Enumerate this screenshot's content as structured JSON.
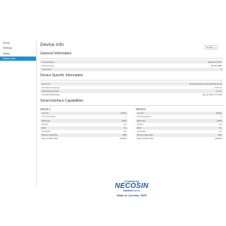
{
  "sidebar": {
    "items": [
      {
        "label": "Home"
      },
      {
        "label": "Settings"
      },
      {
        "label": "Status"
      },
      {
        "label": "Device Info"
      }
    ],
    "active_index": 3
  },
  "header": {
    "title": "Device Info",
    "language": "English"
  },
  "general": {
    "title": "General Information",
    "rows": [
      {
        "label": "Product Name",
        "value": "ESConnect Pro"
      },
      {
        "label": "Product Code",
        "value": "ES-WLNMB"
      },
      {
        "label": "Comments",
        "value": "0"
      }
    ]
  },
  "specific": {
    "title": "Device Specific Information",
    "rows": [
      {
        "label": "Device ID",
        "value": "00:11:E8:00:00:10:00:00:00:00:00:00"
      },
      {
        "label": "Firmware Version(s)",
        "value": "0.5.1.11"
      },
      {
        "label": "HW Module Version",
        "value": "V1.0.0"
      },
      {
        "label": "Firmware Build Date",
        "value": "Sep 11 2024 17:04:48"
      }
    ]
  },
  "serial": {
    "title": "Serial Interface Capabilities",
    "ports": [
      {
        "name": "Serial-1",
        "rows": [
          {
            "label": "Use Port",
            "value": "Enable"
          },
          {
            "label": "TCP Connections",
            "value": "4"
          },
          {
            "label": "Buffer Size",
            "value": "32000"
          },
          {
            "label": "Number",
            "value": "Yes"
          },
          {
            "label": "Mask",
            "value": "Yes"
          },
          {
            "label": "Termination",
            "value": "Yes"
          },
          {
            "label": "Minimum Baud Rate",
            "value": "9600"
          },
          {
            "label": "Maximum Baud Rate",
            "value": "1000000"
          }
        ]
      },
      {
        "name": "Serial-2",
        "rows": [
          {
            "label": "Use Port",
            "value": "Enable"
          },
          {
            "label": "TCP Connections",
            "value": "4"
          },
          {
            "label": "Buffer Size",
            "value": "32000"
          },
          {
            "label": "Number",
            "value": "Yes"
          },
          {
            "label": "Mask",
            "value": "Yes"
          },
          {
            "label": "Termination",
            "value": "Yes"
          },
          {
            "label": "Minimum Baud Rate",
            "value": "9600"
          },
          {
            "label": "Maximum Baud Rate",
            "value": "1000000"
          }
        ]
      }
    ]
  },
  "footer": {
    "created_by": "Created by",
    "brand": "NECOSIN",
    "brand_sub": "Systems s.r.o.",
    "made_in": "Made in Czechia, 2025"
  },
  "colors": {
    "accent": "#1e8ed8",
    "brand": "#1e5aa8",
    "row_stripe": "#ececec"
  }
}
